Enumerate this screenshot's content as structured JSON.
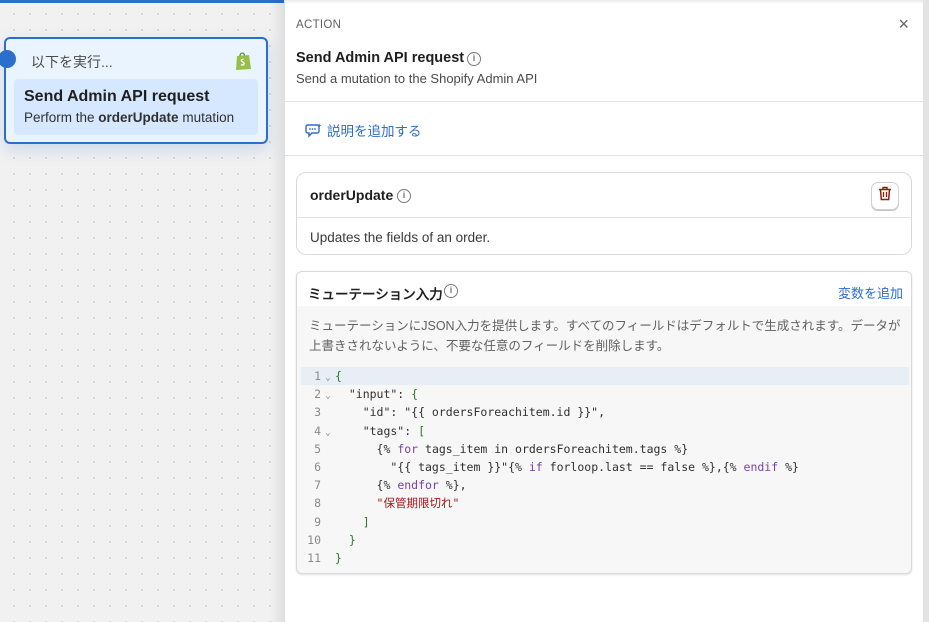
{
  "canvas": {
    "node": {
      "header": "以下を実行...",
      "icon": "shopify-bag-icon",
      "title": "Send Admin API request",
      "subtitle_prefix": "Perform the",
      "subtitle_bold": "orderUpdate",
      "subtitle_suffix": "mutation"
    }
  },
  "panel": {
    "section_label": "ACTION",
    "close_icon": "×",
    "title": "Send Admin API request",
    "description": "Send a mutation to the Shopify Admin API",
    "add_description_label": "説明を追加する",
    "mutation_card": {
      "title": "orderUpdate",
      "description": "Updates the fields of an order."
    },
    "input_card": {
      "title": "ミューテーション入力",
      "add_variable_label": "変数を追加",
      "description": "ミューテーションにJSON入力を提供します。すべてのフィールドはデフォルトで生成されます。データが上書きされないように、不要な任意のフィールドを削除します。"
    },
    "code_lines": [
      {
        "n": "1",
        "fold": "⌄",
        "indent": "",
        "text": "{"
      },
      {
        "n": "2",
        "fold": "⌄",
        "indent": "  ",
        "text": "\"input\": {"
      },
      {
        "n": "3",
        "fold": "",
        "indent": "    ",
        "text": "\"id\": \"{{ ordersForeachitem.id }}\","
      },
      {
        "n": "4",
        "fold": "⌄",
        "indent": "    ",
        "text": "\"tags\": ["
      },
      {
        "n": "5",
        "fold": "",
        "indent": "      ",
        "text": "{% for tags_item in ordersForeachitem.tags %}"
      },
      {
        "n": "6",
        "fold": "",
        "indent": "        ",
        "text": "\"{{ tags_item }}\"{% if forloop.last == false %},{% endif %}"
      },
      {
        "n": "7",
        "fold": "",
        "indent": "      ",
        "text": "{% endfor %},"
      },
      {
        "n": "8",
        "fold": "",
        "indent": "      ",
        "text": "\"保管期限切れ\""
      },
      {
        "n": "9",
        "fold": "",
        "indent": "    ",
        "text": "]"
      },
      {
        "n": "10",
        "fold": "",
        "indent": "  ",
        "text": "}"
      },
      {
        "n": "11",
        "fold": "",
        "indent": "",
        "text": "}"
      }
    ]
  },
  "colors": {
    "accent": "#2c6ecb",
    "node_bg": "#eaf4ff",
    "trash": "#8e1f0b",
    "string_red": "#a31515",
    "keyword": "#7a3eb1",
    "bracket": "#2a7a2a"
  }
}
